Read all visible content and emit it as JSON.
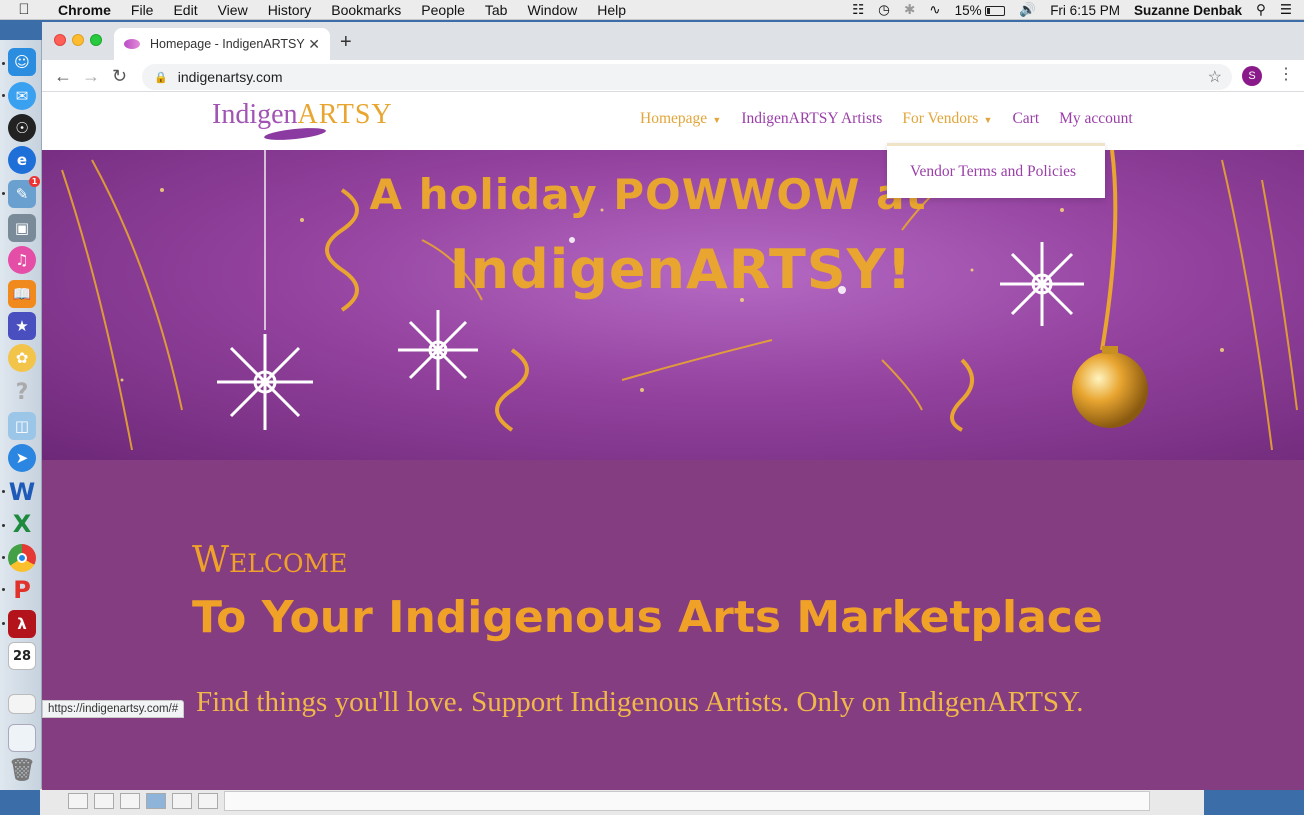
{
  "menubar": {
    "app": "Chrome",
    "items": [
      "File",
      "Edit",
      "View",
      "History",
      "Bookmarks",
      "People",
      "Tab",
      "Window",
      "Help"
    ],
    "battery": "15%",
    "clock": "Fri 6:15 PM",
    "user": "Suzanne Denbak"
  },
  "browser": {
    "tab_title": "Homepage - IndigenARTSY",
    "url": "indigenartsy.com",
    "profile_initial": "S",
    "status_url": "https://indigenartsy.com/#"
  },
  "site": {
    "logo_part1": "Indigen",
    "logo_part2": "ARTSY",
    "nav": {
      "homepage": "Homepage",
      "artists": "IndigenARTSY Artists",
      "vendors": "For Vendors",
      "cart": "Cart",
      "account": "My account"
    },
    "dropdown_item": "Vendor Terms and Policies",
    "hero": {
      "line1": "A holiday POWWOW at",
      "line2": "IndigenARTSY!"
    },
    "welcome": {
      "heading": "Welcome",
      "subheading": "To Your Indigenous Arts Marketplace",
      "tagline": "Find things you'll love. Support Indigenous Artists. Only on IndigenARTSY."
    }
  },
  "dock": {
    "calendar_day": "28",
    "badge": "1"
  },
  "colors": {
    "brand_purple": "#853d81",
    "gold": "#f0a228",
    "nav_purple": "#9a3fa8"
  }
}
